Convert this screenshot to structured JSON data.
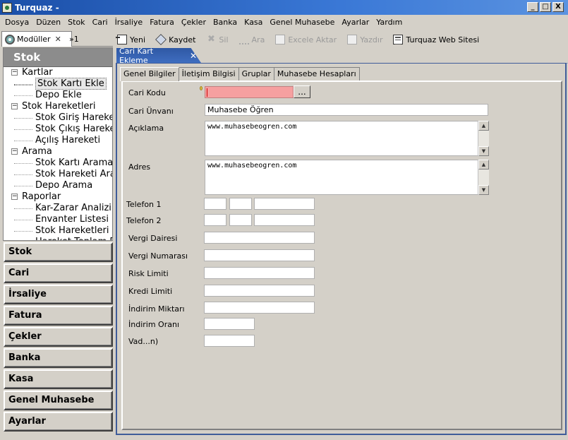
{
  "window": {
    "title": "Turquaz -",
    "controls": {
      "minimize": "_",
      "maximize": "□",
      "close": "X"
    }
  },
  "menu": [
    "Dosya",
    "Düzen",
    "Stok",
    "Cari",
    "İrsaliye",
    "Fatura",
    "Çekler",
    "Banka",
    "Kasa",
    "Genel Muhasebe",
    "Ayarlar",
    "Yardım"
  ],
  "left_tabs": {
    "modules": "Modüller",
    "overflow": "»1"
  },
  "module_panel": {
    "header": "Stok",
    "tree": [
      {
        "label": "Kartlar",
        "level": 0,
        "expander": "−"
      },
      {
        "label": "Stok Kartı Ekle",
        "level": 1,
        "selected": true
      },
      {
        "label": "Depo Ekle",
        "level": 1
      },
      {
        "label": "Stok Hareketleri",
        "level": 0,
        "expander": "−"
      },
      {
        "label": "Stok Giriş Hareketi",
        "level": 1
      },
      {
        "label": "Stok Çıkış Hareketi",
        "level": 1
      },
      {
        "label": "Açılış Hareketi",
        "level": 1
      },
      {
        "label": "Arama",
        "level": 0,
        "expander": "−"
      },
      {
        "label": "Stok Kartı Arama",
        "level": 1
      },
      {
        "label": "Stok Hareketi Arama",
        "level": 1
      },
      {
        "label": "Depo Arama",
        "level": 1
      },
      {
        "label": "Raporlar",
        "level": 0,
        "expander": "−"
      },
      {
        "label": "Kar-Zarar Analizi",
        "level": 1
      },
      {
        "label": "Envanter Listesi",
        "level": 1
      },
      {
        "label": "Stok Hareketleri Raporu",
        "level": 1
      },
      {
        "label": "Hareket Toplam Raporu",
        "level": 1
      }
    ]
  },
  "module_buttons": [
    "Stok",
    "Cari",
    "İrsaliye",
    "Fatura",
    "Çekler",
    "Banka",
    "Kasa",
    "Genel Muhasebe",
    "Ayarlar"
  ],
  "toolbar": {
    "new": "Yeni",
    "save": "Kaydet",
    "delete": "Sil",
    "search": "Ara",
    "excel": "Excele Aktar",
    "print": "Yazdır",
    "website": "Turquaz Web Sitesi"
  },
  "editor_tab": {
    "title": "Cari Kart Ekleme",
    "close": "✕"
  },
  "sub_tabs": [
    "Genel Bilgiler",
    "İletişim Bilgisi",
    "Gruplar",
    "Muhasebe Hesapları"
  ],
  "form": {
    "cari_kodu": {
      "label": "Cari Kodu",
      "value": "",
      "button": "..."
    },
    "cari_unvani": {
      "label": "Cari Ünvanı",
      "value": "Muhasebe Öğren"
    },
    "aciklama": {
      "label": "Açıklama",
      "value": "www.muhasebeogren.com"
    },
    "adres": {
      "label": "Adres",
      "value": "www.muhasebeogren.com"
    },
    "telefon1": {
      "label": "Telefon 1"
    },
    "telefon2": {
      "label": "Telefon 2"
    },
    "vergi_dairesi": {
      "label": "Vergi Dairesi"
    },
    "vergi_numarasi": {
      "label": "Vergi Numarası"
    },
    "risk_limiti": {
      "label": "Risk Limiti"
    },
    "kredi_limiti": {
      "label": "Kredi Limiti"
    },
    "indirim_miktari": {
      "label": "İndirim Miktarı"
    },
    "indirim_orani": {
      "label": "İndirim Oranı"
    },
    "vade": {
      "label": "Vad...n)"
    }
  },
  "colors": {
    "title_bar": "#2a5fbf",
    "required_field": "#f6a0a0",
    "editor_tab": "#3a64b4"
  }
}
